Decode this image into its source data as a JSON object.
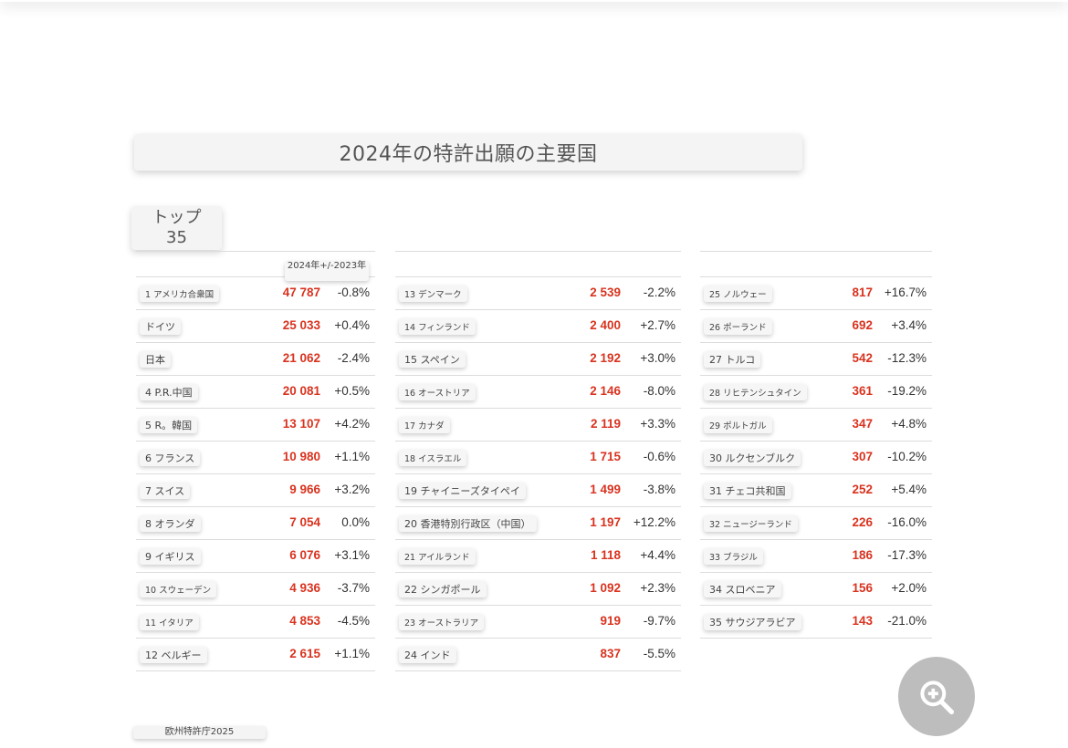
{
  "title": "2024年の特許出願の主要国",
  "top_label_1": "トップ",
  "top_label_2": "35",
  "header_change": "2024年+/-2023年",
  "footer": "欧州特許庁2025",
  "zoom_icon": "zoom-in-icon",
  "colors": {
    "value_red": "#d9331f",
    "zoom_bg": "#bdbdbd"
  },
  "table": {
    "col1": [
      {
        "name": "1 アメリカ合衆国",
        "value": "47 787",
        "change": "-0.8%"
      },
      {
        "name": "ドイツ",
        "value": "25 033",
        "change": "+0.4%"
      },
      {
        "name": "日本",
        "value": "21 062",
        "change": "-2.4%"
      },
      {
        "name": "4 P.R.中国",
        "value": "20 081",
        "change": "+0.5%"
      },
      {
        "name": "5 R。韓国",
        "value": "13 107",
        "change": "+4.2%"
      },
      {
        "name": "6 フランス",
        "value": "10 980",
        "change": "+1.1%"
      },
      {
        "name": "7 スイス",
        "value": "9 966",
        "change": "+3.2%"
      },
      {
        "name": "8 オランダ",
        "value": "7 054",
        "change": "0.0%"
      },
      {
        "name": "9 イギリス",
        "value": "6 076",
        "change": "+3.1%"
      },
      {
        "name": "10 スウェーデン",
        "value": "4 936",
        "change": "-3.7%"
      },
      {
        "name": "11 イタリア",
        "value": "4 853",
        "change": "-4.5%"
      },
      {
        "name": "12 ベルギー",
        "value": "2 615",
        "change": "+1.1%"
      }
    ],
    "col2": [
      {
        "name": "13 デンマーク",
        "value": "2 539",
        "change": "-2.2%"
      },
      {
        "name": "14 フィンランド",
        "value": "2 400",
        "change": "+2.7%"
      },
      {
        "name": "15 スペイン",
        "value": "2 192",
        "change": "+3.0%"
      },
      {
        "name": "16 オーストリア",
        "value": "2 146",
        "change": "-8.0%"
      },
      {
        "name": "17 カナダ",
        "value": "2 119",
        "change": "+3.3%"
      },
      {
        "name": "18 イスラエル",
        "value": "1 715",
        "change": "-0.6%"
      },
      {
        "name": "19 チャイニーズタイペイ",
        "value": "1 499",
        "change": "-3.8%"
      },
      {
        "name": "20 香港特別行政区（中国）",
        "value": "1 197",
        "change": "+12.2%"
      },
      {
        "name": "21 アイルランド",
        "value": "1 118",
        "change": "+4.4%"
      },
      {
        "name": "22 シンガポール",
        "value": "1 092",
        "change": "+2.3%"
      },
      {
        "name": "23 オーストラリア",
        "value": "919",
        "change": "-9.7%"
      },
      {
        "name": "24 インド",
        "value": "837",
        "change": "-5.5%"
      }
    ],
    "col3": [
      {
        "name": "25 ノルウェー",
        "value": "817",
        "change": "+16.7%"
      },
      {
        "name": "26 ポーランド",
        "value": "692",
        "change": "+3.4%"
      },
      {
        "name": "27 トルコ",
        "value": "542",
        "change": "-12.3%"
      },
      {
        "name": "28 リヒテンシュタイン",
        "value": "361",
        "change": "-19.2%"
      },
      {
        "name": "29 ポルトガル",
        "value": "347",
        "change": "+4.8%"
      },
      {
        "name": "30 ルクセンブルク",
        "value": "307",
        "change": "-10.2%"
      },
      {
        "name": "31 チェコ共和国",
        "value": "252",
        "change": "+5.4%"
      },
      {
        "name": "32 ニュージーランド",
        "value": "226",
        "change": "-16.0%"
      },
      {
        "name": "33 ブラジル",
        "value": "186",
        "change": "-17.3%"
      },
      {
        "name": "34 スロベニア",
        "value": "156",
        "change": "+2.0%"
      },
      {
        "name": "35 サウジアラビア",
        "value": "143",
        "change": "-21.0%"
      }
    ]
  }
}
